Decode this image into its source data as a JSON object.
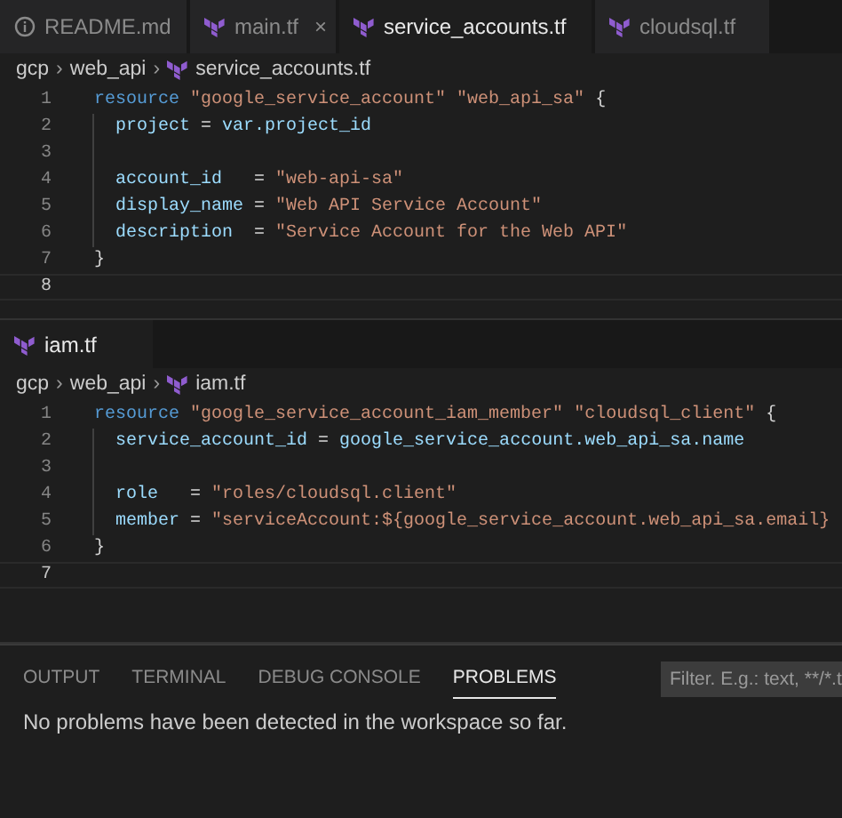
{
  "editors": [
    {
      "tabs": [
        {
          "label": "README.md",
          "kind": "info",
          "selected": false
        },
        {
          "label": "main.tf",
          "kind": "file",
          "selected": false,
          "close": "×"
        },
        {
          "label": "service_accounts.tf",
          "kind": "file",
          "selected": true
        },
        {
          "label": "cloudsql.tf",
          "kind": "file",
          "selected": false
        }
      ],
      "breadcrumb": [
        {
          "label": "gcp",
          "kind": "folder"
        },
        {
          "label": "web_api",
          "kind": "folder",
          "separator": "›"
        },
        {
          "label": "service_accounts.tf",
          "kind": "file",
          "separator": "›"
        }
      ],
      "lines": [
        {
          "number": "1",
          "indent": false,
          "current": false,
          "tokens": [
            {
              "kind": "keyword",
              "text": "resource"
            },
            {
              "kind": "string",
              "text": "\"google_service_account\""
            },
            {
              "kind": "string",
              "text": "\"web_api_sa\""
            },
            {
              "kind": "punct",
              "text": "{"
            }
          ]
        },
        {
          "number": "2",
          "indent": true,
          "current": false,
          "tokens": [
            {
              "kind": "attr",
              "text": "project"
            },
            {
              "kind": "punct",
              "text": "="
            },
            {
              "kind": "attr",
              "text": "var.project_id"
            }
          ]
        },
        {
          "number": "3",
          "indent": true,
          "current": false
        },
        {
          "number": "4",
          "indent": true,
          "current": false,
          "tokens": [
            {
              "kind": "attr",
              "text": "account_id"
            },
            {
              "kind": "punct",
              "text": "  ="
            },
            {
              "kind": "string",
              "text": "\"web-api-sa\""
            }
          ]
        },
        {
          "number": "5",
          "indent": true,
          "current": false,
          "tokens": [
            {
              "kind": "attr",
              "text": "display_name"
            },
            {
              "kind": "punct",
              "text": "="
            },
            {
              "kind": "string",
              "text": "\"Web API Service Account\""
            }
          ]
        },
        {
          "number": "6",
          "indent": true,
          "current": false,
          "tokens": [
            {
              "kind": "attr",
              "text": "description"
            },
            {
              "kind": "punct",
              "text": " ="
            },
            {
              "kind": "string",
              "text": "\"Service Account for the Web API\""
            }
          ]
        },
        {
          "number": "7",
          "indent": false,
          "current": false,
          "tokens": [
            {
              "kind": "punct",
              "text": "}"
            }
          ]
        },
        {
          "number": "8",
          "indent": false,
          "current": true
        }
      ]
    },
    {
      "tabs": [
        {
          "label": "iam.tf",
          "kind": "file",
          "selected": true
        }
      ],
      "breadcrumb": [
        {
          "label": "gcp",
          "kind": "folder"
        },
        {
          "label": "web_api",
          "kind": "folder",
          "separator": "›"
        },
        {
          "label": "iam.tf",
          "kind": "file",
          "separator": "›"
        }
      ],
      "lines": [
        {
          "number": "1",
          "indent": false,
          "current": false,
          "tokens": [
            {
              "kind": "keyword",
              "text": "resource"
            },
            {
              "kind": "string",
              "text": "\"google_service_account_iam_member\""
            },
            {
              "kind": "string",
              "text": "\"cloudsql_client\""
            },
            {
              "kind": "punct",
              "text": "{"
            }
          ]
        },
        {
          "number": "2",
          "indent": true,
          "current": false,
          "tokens": [
            {
              "kind": "attr",
              "text": "service_account_id"
            },
            {
              "kind": "punct",
              "text": "="
            },
            {
              "kind": "attr",
              "text": "google_service_account.web_api_sa.name"
            }
          ]
        },
        {
          "number": "3",
          "indent": true,
          "current": false
        },
        {
          "number": "4",
          "indent": true,
          "current": false,
          "tokens": [
            {
              "kind": "attr",
              "text": "role"
            },
            {
              "kind": "punct",
              "text": "  ="
            },
            {
              "kind": "string",
              "text": "\"roles/cloudsql.client\""
            }
          ]
        },
        {
          "number": "5",
          "indent": true,
          "current": false,
          "tokens": [
            {
              "kind": "attr",
              "text": "member"
            },
            {
              "kind": "punct",
              "text": "="
            },
            {
              "kind": "string",
              "text": "\"serviceAccount:${google_service_account.web_api_sa.email}"
            }
          ]
        },
        {
          "number": "6",
          "indent": false,
          "current": false,
          "tokens": [
            {
              "kind": "punct",
              "text": "}"
            }
          ]
        },
        {
          "number": "7",
          "indent": false,
          "current": true
        }
      ]
    }
  ],
  "panel": {
    "tabs": [
      {
        "label": "OUTPUT",
        "selected": false
      },
      {
        "label": "TERMINAL",
        "selected": false
      },
      {
        "label": "DEBUG CONSOLE",
        "selected": false
      },
      {
        "label": "PROBLEMS",
        "selected": true
      }
    ],
    "filter": {
      "placeholder": "Filter. E.g.: text, **/*.t"
    },
    "message": "No problems have been detected in the workspace so far."
  }
}
